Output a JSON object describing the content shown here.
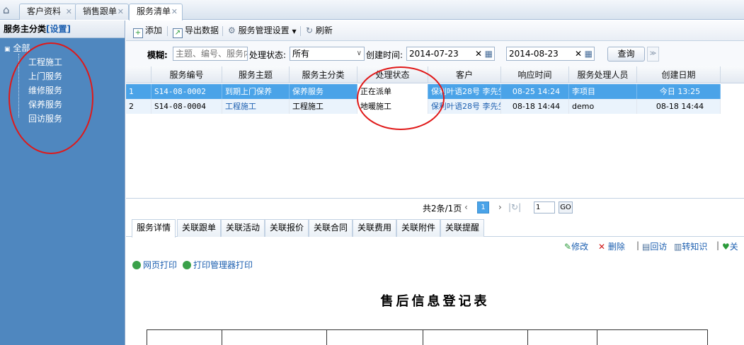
{
  "tabs": [
    {
      "label": "客户资料"
    },
    {
      "label": "销售跟单"
    },
    {
      "label": "服务清单"
    }
  ],
  "sidebar": {
    "title": "服务主分类",
    "settings_link": "[设置]",
    "root": "全部",
    "items": [
      {
        "label": "工程施工"
      },
      {
        "label": "上门服务"
      },
      {
        "label": "维修服务"
      },
      {
        "label": "保养服务"
      },
      {
        "label": "回访服务"
      }
    ]
  },
  "toolbar": {
    "add": "添加",
    "export": "导出数据",
    "settings": "服务管理设置",
    "refresh": "刷新"
  },
  "filter": {
    "fuzzy_label": "模糊:",
    "fuzzy_placeholder": "主题、编号、服务内",
    "status_label": "处理状态:",
    "status_value": "所有",
    "created_label": "创建时间:",
    "date_from": "2014-07-23",
    "date_to": "2014-08-23",
    "query": "查询"
  },
  "grid": {
    "headers": [
      "服务编号",
      "服务主题",
      "服务主分类",
      "处理状态",
      "客户",
      "响应时间",
      "服务处理人员",
      "创建日期"
    ],
    "rows": [
      {
        "num": "1",
        "cells": [
          "S14-08-0002",
          "到期上门保养",
          "保养服务",
          "正在派单",
          "保利叶语28号 李先生",
          "08-25 14:24",
          "李项目",
          "今日 13:25"
        ]
      },
      {
        "num": "2",
        "cells": [
          "S14-08-0004",
          "工程施工",
          "工程施工",
          "地暖施工",
          "保利叶语28号 李先生",
          "08-18 14:44",
          "demo",
          "08-18 14:44"
        ]
      }
    ]
  },
  "pager": {
    "summary": "共2条/1页",
    "current": "1",
    "goto_value": "1",
    "go": "GO"
  },
  "detail_tabs": [
    {
      "label": "服务详情"
    },
    {
      "label": "关联跟单"
    },
    {
      "label": "关联活动"
    },
    {
      "label": "关联报价"
    },
    {
      "label": "关联合同"
    },
    {
      "label": "关联费用"
    },
    {
      "label": "关联附件"
    },
    {
      "label": "关联提醒"
    }
  ],
  "actions": {
    "edit": "修改",
    "delete": "删除",
    "visit": "回访",
    "to_knowledge": "转知识",
    "more": "关"
  },
  "print": {
    "web": "网页打印",
    "manager": "打印管理器打印"
  },
  "document": {
    "title": "售后信息登记表"
  },
  "colors": {
    "selected_row": "#4aa3e8",
    "tree_bg": "#4f87bf",
    "annotation": "#e01818"
  }
}
